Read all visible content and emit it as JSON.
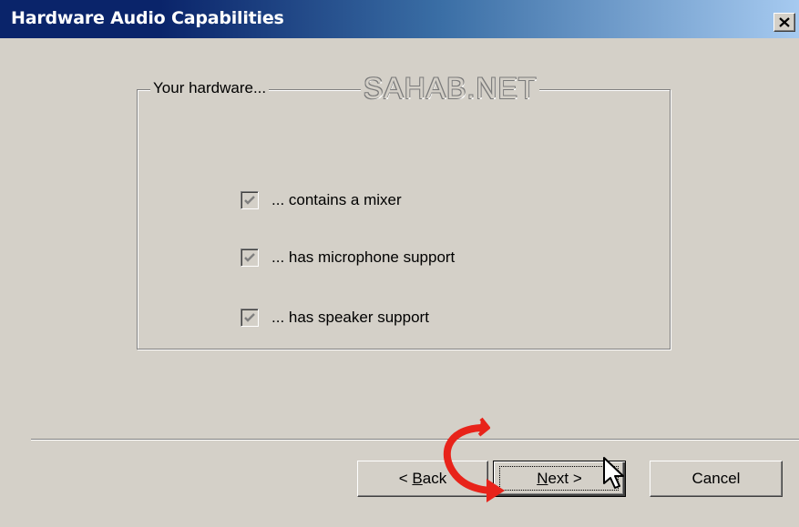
{
  "window": {
    "title": "Hardware Audio Capabilities",
    "close_glyph": "✕"
  },
  "group": {
    "label": "Your hardware...",
    "watermark": "SAHAB.NET"
  },
  "checks": [
    {
      "label": "... contains a mixer",
      "checked": true,
      "disabled": true
    },
    {
      "label": "... has microphone support",
      "checked": true,
      "disabled": true
    },
    {
      "label": "... has speaker support",
      "checked": true,
      "disabled": true
    }
  ],
  "buttons": {
    "back": {
      "before": "< ",
      "mnemonic": "B",
      "after": "ack"
    },
    "next": {
      "mnemonic": "N",
      "after": "ext >"
    },
    "cancel": "Cancel"
  },
  "colors": {
    "title_start": "#0a246a",
    "title_end": "#a6caf0",
    "dialog_face": "#d4d0c8",
    "annotation_arrow": "#e8231a"
  },
  "icons": [
    "close-icon",
    "check-icon",
    "curved-arrow-icon",
    "mouse-pointer-icon"
  ]
}
